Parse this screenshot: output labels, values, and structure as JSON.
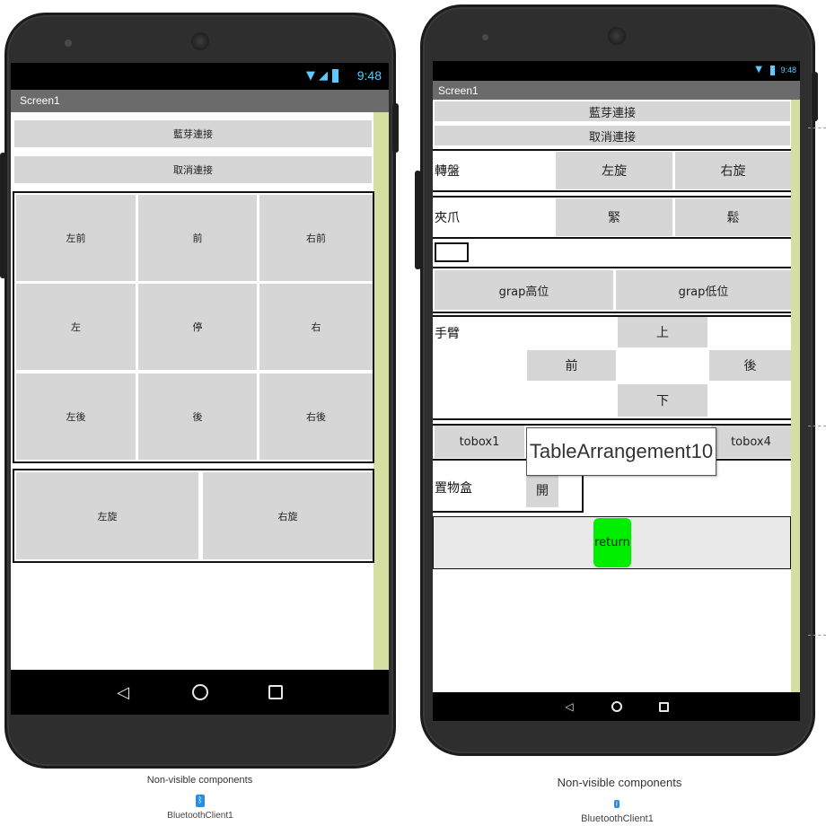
{
  "status": {
    "time": "9:48",
    "time_small": "9:48"
  },
  "left_phone": {
    "screen_title": "Screen1",
    "bluetooth_connect": "藍芽連接",
    "bluetooth_disconnect": "取消連接",
    "grid": [
      [
        "左前",
        "前",
        "右前"
      ],
      [
        "左",
        "停",
        "右"
      ],
      [
        "左後",
        "後",
        "右後"
      ]
    ],
    "rotate_left": "左旋",
    "rotate_right": "右旋"
  },
  "right_phone": {
    "screen_title": "Screen1",
    "bluetooth_connect": "藍芽連接",
    "bluetooth_disconnect": "取消連接",
    "turntable": {
      "label": "轉盤",
      "left": "左旋",
      "right": "右旋"
    },
    "gripper": {
      "label": "夾爪",
      "tight": "緊",
      "loose": "鬆"
    },
    "grap_high": "grap高位",
    "grap_low": "grap低位",
    "arm": {
      "label": "手臂",
      "up": "上",
      "forward": "前",
      "back": "後",
      "down": "下"
    },
    "tobox1": "tobox1",
    "tobox4": "tobox4",
    "tooltip": "TableArrangement10",
    "storage": {
      "label": "置物盒",
      "open": "開"
    },
    "return_label": "return"
  },
  "footer_left": {
    "title": "Non-visible components",
    "component": "BluetoothClient1"
  },
  "footer_right": {
    "title": "Non-visible components",
    "component": "BluetoothClient1"
  },
  "colors": {
    "return_green": "#00ee00",
    "button_grey": "#d6d6d6",
    "rail": "#d5dfa2"
  },
  "icons": [
    "wifi-icon",
    "signal-icon",
    "battery-icon",
    "back-icon",
    "home-icon",
    "recents-icon",
    "bluetooth-icon"
  ]
}
